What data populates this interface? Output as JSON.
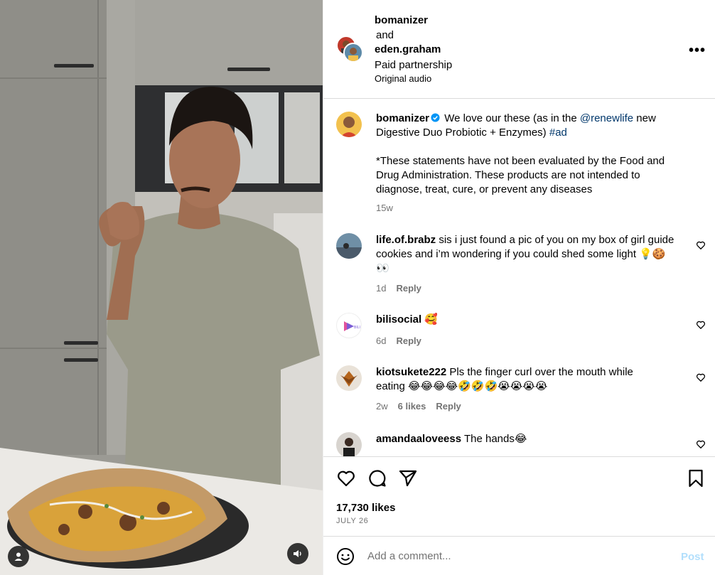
{
  "post_header": {
    "user1": "bomanizer",
    "and_text": "and",
    "user2": "eden.graham",
    "paid_label": "Paid partnership",
    "audio_label": "Original audio"
  },
  "caption": {
    "username": "bomanizer",
    "text_before": "We love our these (as in the ",
    "mention": "@renewlife",
    "text_middle": " new Digestive Duo Probiotic + Enzymes) ",
    "hashtag": "#ad",
    "disclaimer": "*These statements have not been evaluated by the Food and Drug Administration. These products are not intended to diagnose, treat, cure, or prevent any diseases",
    "time": "15w"
  },
  "comments": [
    {
      "username": "life.of.brabz",
      "text": "sis i just found a pic of you on my box of girl guide cookies and i’m wondering if you could shed some light 💡🍪👀",
      "time": "1d",
      "likes": "",
      "reply": "Reply"
    },
    {
      "username": "bilisocial",
      "text": "🥰",
      "time": "6d",
      "likes": "",
      "reply": "Reply"
    },
    {
      "username": "kiotsukete222",
      "text": "Pls the finger curl over the mouth while eating 😂😂😂😂🤣🤣🤣😭😭😭😭",
      "time": "2w",
      "likes": "6 likes",
      "reply": "Reply"
    },
    {
      "username": "amandaaloveess",
      "text": "The hands😂",
      "time": "",
      "likes": "",
      "reply": ""
    }
  ],
  "stats": {
    "likes": "17,730 likes",
    "date": "JULY 26"
  },
  "composer": {
    "placeholder": "Add a comment...",
    "post_label": "Post"
  },
  "icons": {
    "like": "heart-icon",
    "comment": "comment-icon",
    "share": "paper-plane-icon",
    "save": "bookmark-icon",
    "emoji": "smiley-icon",
    "more": "more-options-icon",
    "tagged": "user-icon",
    "audio": "speaker-icon"
  },
  "colors": {
    "link": "#00376b",
    "muted": "#737373",
    "verified": "#0095f6",
    "post_disabled": "#b2dffc"
  }
}
